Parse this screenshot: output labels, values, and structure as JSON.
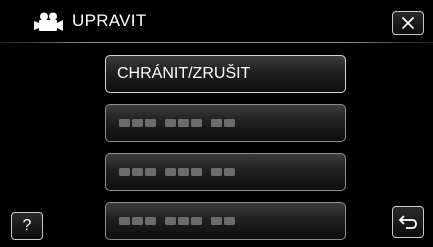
{
  "header": {
    "title": "UPRAVIT",
    "mode_icon": "video-camera-icon",
    "close_icon": "close-icon"
  },
  "menu": {
    "items": [
      {
        "label": "CHRÁNIT/ZRUŠIT",
        "state": "enabled"
      },
      {
        "label": "",
        "state": "disabled"
      },
      {
        "label": "",
        "state": "disabled"
      },
      {
        "label": "",
        "state": "disabled"
      }
    ]
  },
  "footer": {
    "help_label": "?",
    "back_icon": "return-arrow-icon"
  },
  "colors": {
    "background": "#000000",
    "text": "#ffffff",
    "border": "#d4d4d4",
    "disabled": "#8d8d8d"
  }
}
